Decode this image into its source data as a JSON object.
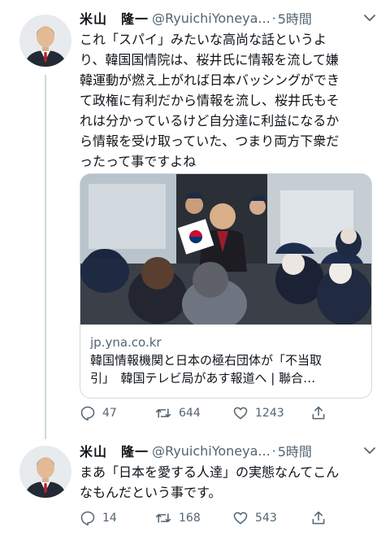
{
  "tweets": [
    {
      "display_name": "米山　隆一",
      "handle": "@RyuichiYoneya...",
      "separator": "·",
      "time": "5時間",
      "lines": [
        "これ「スパイ」みたいな高尚な話というよ",
        "り、韓国国情院は、桜井氏に情報を流して嫌",
        "韓運動が燃え上がれば日本バッシングができ",
        "て政権に有利だから情報を流し、桜井氏もそ",
        "れは分かっているけど自分達に利益になるか",
        "ら情報を受け取っていた、つまり両方下衆だ",
        "ったって事ですよね"
      ],
      "card": {
        "domain": "jp.yna.co.kr",
        "title_line1": "韓国情報機関と日本の極右団体が「不当取",
        "title_line2": "引」　韓国テレビ局があす報道へ | 聯合…"
      },
      "replies": "47",
      "retweets": "644",
      "likes": "1243"
    },
    {
      "display_name": "米山　隆一",
      "handle": "@RyuichiYoneya...",
      "separator": "·",
      "time": "5時間",
      "lines": [
        "まあ「日本を愛する人達」の実態なんてこん",
        "なもんだという事です。"
      ],
      "replies": "14",
      "retweets": "168",
      "likes": "543"
    }
  ],
  "colors": {
    "text": "#0f1419",
    "secondary": "#536471",
    "border": "#cfd9de"
  },
  "icons": [
    "more-icon",
    "reply-icon",
    "retweet-icon",
    "like-icon",
    "share-icon"
  ]
}
